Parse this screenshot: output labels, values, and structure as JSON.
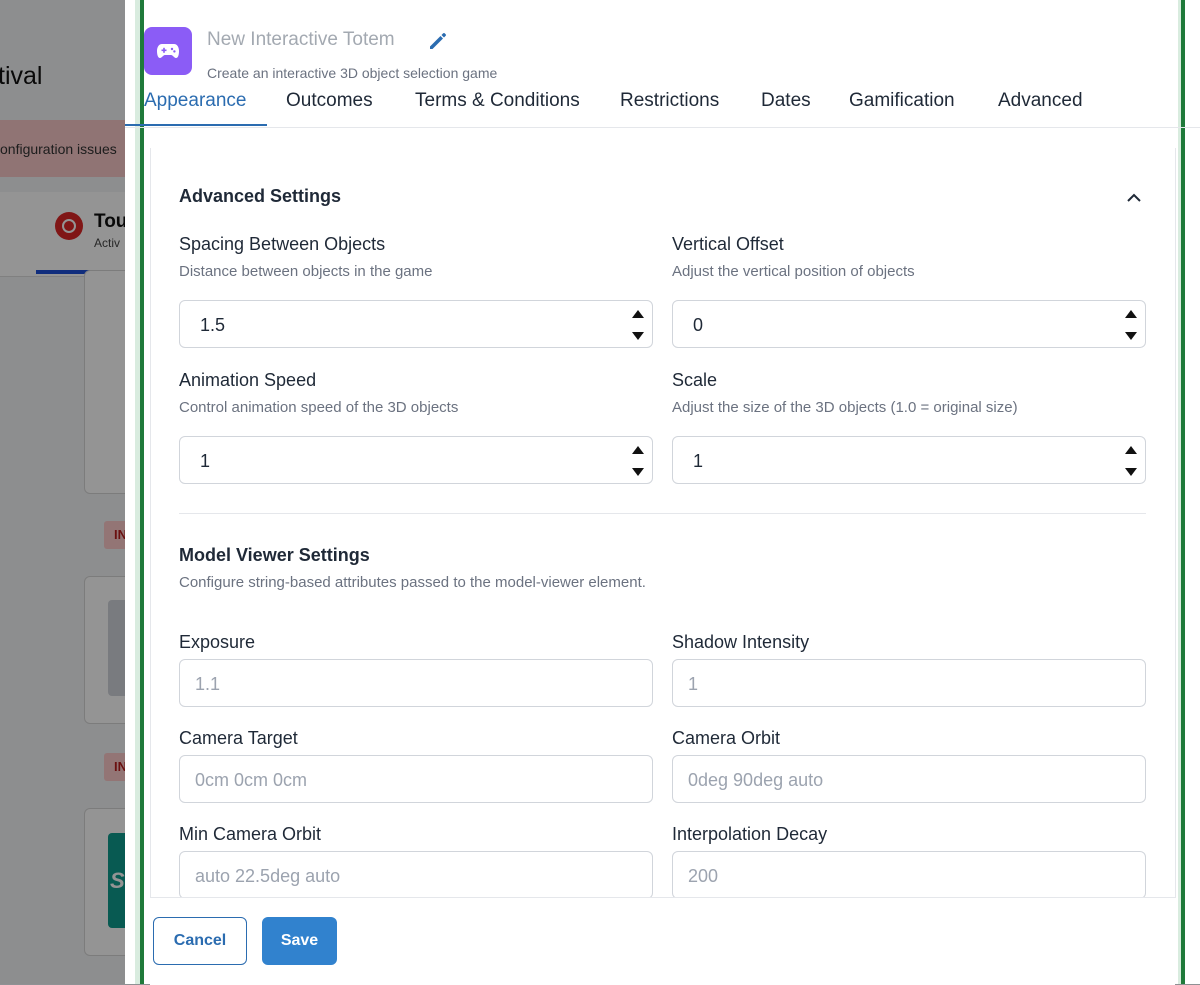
{
  "background": {
    "title_fragment": "tival",
    "alert_text": "onfiguration issues",
    "tab_label": "Tou",
    "tab_sub": "Activ",
    "badge_text": "IN",
    "teal_text": "SP"
  },
  "header": {
    "title": "New Interactive Totem",
    "subtitle": "Create an interactive 3D object selection game"
  },
  "tabs": [
    {
      "label": "Appearance",
      "active": true
    },
    {
      "label": "Outcomes"
    },
    {
      "label": "Terms & Conditions"
    },
    {
      "label": "Restrictions"
    },
    {
      "label": "Dates"
    },
    {
      "label": "Gamification"
    },
    {
      "label": "Advanced"
    }
  ],
  "advanced_settings": {
    "title": "Advanced Settings",
    "fields": [
      {
        "label": "Spacing Between Objects",
        "help": "Distance between objects in the game",
        "value": "1.5"
      },
      {
        "label": "Vertical Offset",
        "help": "Adjust the vertical position of objects",
        "value": "0"
      },
      {
        "label": "Animation Speed",
        "help": "Control animation speed of the 3D objects",
        "value": "1"
      },
      {
        "label": "Scale",
        "help": "Adjust the size of the 3D objects (1.0 = original size)",
        "value": "1"
      }
    ]
  },
  "model_viewer": {
    "title": "Model Viewer Settings",
    "help": "Configure string-based attributes passed to the model-viewer element.",
    "fields": [
      {
        "label": "Exposure",
        "placeholder": "1.1"
      },
      {
        "label": "Shadow Intensity",
        "placeholder": "1"
      },
      {
        "label": "Camera Target",
        "placeholder": "0cm 0cm 0cm"
      },
      {
        "label": "Camera Orbit",
        "placeholder": "0deg 90deg auto"
      },
      {
        "label": "Min Camera Orbit",
        "placeholder": "auto 22.5deg auto"
      },
      {
        "label": "Interpolation Decay",
        "placeholder": "200"
      }
    ]
  },
  "footer": {
    "cancel_label": "Cancel",
    "save_label": "Save"
  },
  "colors": {
    "accent": "#2b6cb0",
    "primary_button": "#3182ce",
    "game_icon_bg": "#8b5cf6",
    "frame_green": "#1f7a3a"
  }
}
